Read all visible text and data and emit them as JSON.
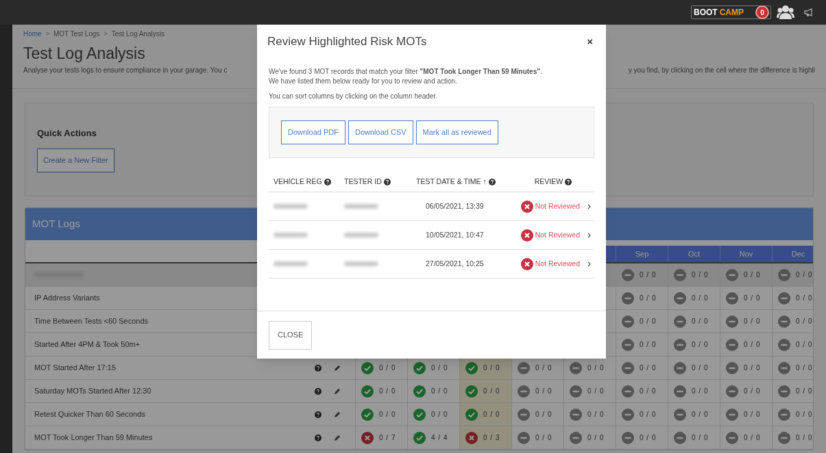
{
  "topbar": {
    "logo": {
      "part1": "BOOT",
      "part2": "CAMP"
    },
    "badge": "0"
  },
  "breadcrumb": [
    "Home",
    "MOT Test Logs",
    "Test Log Analysis"
  ],
  "breadcrumb_separator": ">",
  "page_title": "Test Log Analysis",
  "subtitle_left": "Analyse your tests logs to ensure compliance in your garage. You c",
  "subtitle_right": "y you find, by clicking on the cell where the difference is highli",
  "quick_actions": {
    "title": "Quick Actions",
    "button": "Create a New Filter"
  },
  "mot_logs": {
    "title": "MOT Logs",
    "columns": [
      {
        "highlighted": false
      },
      {
        "highlighted": false
      },
      {
        "highlighted": true
      },
      {
        "highlighted": false
      },
      {
        "highlighted": false
      },
      {
        "header": "Sep",
        "highlighted": false
      },
      {
        "header": "Oct",
        "highlighted": false
      },
      {
        "header": "Nov",
        "highlighted": false
      },
      {
        "header": "Dec",
        "highlighted": false
      }
    ],
    "rows": [
      {
        "kind": "group",
        "cells": [
          {
            "kind": "none",
            "value": "0 / 0"
          },
          {
            "kind": "none",
            "value": "0 / 0"
          },
          {
            "kind": "none",
            "value": "0 / 0"
          },
          {
            "kind": "none",
            "value": "0 / 0"
          }
        ]
      },
      {
        "kind": "filter",
        "label": "IP Address Variants",
        "cells": [
          {
            "kind": "none",
            "value": "0 / 0"
          },
          {
            "kind": "none",
            "value": "0 / 0"
          },
          {
            "kind": "none",
            "value": "0 / 0"
          },
          {
            "kind": "none",
            "value": "0 / 0"
          }
        ]
      },
      {
        "kind": "filter",
        "label": "Time Between Tests <60 Seconds",
        "cells": [
          {
            "kind": "none",
            "value": "0 / 0"
          },
          {
            "kind": "none",
            "value": "0 / 0"
          },
          {
            "kind": "none",
            "value": "0 / 0"
          },
          {
            "kind": "none",
            "value": "0 / 0"
          }
        ]
      },
      {
        "kind": "filter",
        "label": "Started After 4PM & Took 50m+",
        "cells": [
          {
            "kind": "none",
            "value": "0 / 0"
          },
          {
            "kind": "none",
            "value": "0 / 0"
          },
          {
            "kind": "none",
            "value": "0 / 0"
          },
          {
            "kind": "none",
            "value": "0 / 0"
          }
        ]
      },
      {
        "kind": "filter",
        "label": "MOT Started After 17:15",
        "cells": [
          {
            "kind": "ok",
            "value": "0 / 0"
          },
          {
            "kind": "ok",
            "value": "0 / 0"
          },
          {
            "kind": "ok",
            "value": "0 / 0"
          },
          {
            "kind": "none",
            "value": "0 / 0"
          },
          {
            "kind": "none",
            "value": "0 / 0"
          },
          {
            "kind": "none",
            "value": "0 / 0"
          },
          {
            "kind": "none",
            "value": "0 / 0"
          },
          {
            "kind": "none",
            "value": "0 / 0"
          },
          {
            "kind": "none",
            "value": "0 / 0"
          }
        ]
      },
      {
        "kind": "filter",
        "label": "Saturday MOTs Started After 12:30",
        "cells": [
          {
            "kind": "ok",
            "value": "0 / 0"
          },
          {
            "kind": "ok",
            "value": "0 / 0"
          },
          {
            "kind": "ok",
            "value": "0 / 0"
          },
          {
            "kind": "none",
            "value": "0 / 0"
          },
          {
            "kind": "none",
            "value": "0 / 0"
          },
          {
            "kind": "none",
            "value": "0 / 0"
          },
          {
            "kind": "none",
            "value": "0 / 0"
          },
          {
            "kind": "none",
            "value": "0 / 0"
          },
          {
            "kind": "none",
            "value": "0 / 0"
          }
        ]
      },
      {
        "kind": "filter",
        "label": "Retest Quicker Than 60 Seconds",
        "cells": [
          {
            "kind": "ok",
            "value": "0 / 0"
          },
          {
            "kind": "ok",
            "value": "0 / 0"
          },
          {
            "kind": "ok",
            "value": "0 / 0"
          },
          {
            "kind": "none",
            "value": "0 / 0"
          },
          {
            "kind": "none",
            "value": "0 / 0"
          },
          {
            "kind": "none",
            "value": "0 / 0"
          },
          {
            "kind": "none",
            "value": "0 / 0"
          },
          {
            "kind": "none",
            "value": "0 / 0"
          },
          {
            "kind": "none",
            "value": "0 / 0"
          }
        ]
      },
      {
        "kind": "filter",
        "label": "MOT Took Longer Than 59 Minutes",
        "cells": [
          {
            "kind": "fail",
            "value": "0 / 7"
          },
          {
            "kind": "ok",
            "value": "4 / 4"
          },
          {
            "kind": "fail",
            "value": "0 / 3"
          },
          {
            "kind": "none",
            "value": "0 / 0"
          },
          {
            "kind": "none",
            "value": "0 / 0"
          },
          {
            "kind": "none",
            "value": "0 / 0"
          },
          {
            "kind": "none",
            "value": "0 / 0"
          },
          {
            "kind": "none",
            "value": "0 / 0"
          },
          {
            "kind": "none",
            "value": "0 / 0"
          }
        ]
      }
    ]
  },
  "modal": {
    "title": "Review Highlighted Risk MOTs",
    "close_glyph": "×",
    "intro_lines": [
      "We've found 3 MOT records that match your filter **\"MOT Took Longer Than 59 Minutes\"**.",
      "We have listed them below ready for you to review and action."
    ],
    "sort_hint": "You can sort columns by clicking on the column header.",
    "actions": [
      "Download PDF",
      "Download CSV",
      "Mark all as reviewed"
    ],
    "columns": [
      {
        "label": "VEHICLE REG"
      },
      {
        "label": "TESTER ID"
      },
      {
        "label": "TEST DATE & TIME",
        "sort_glyph": "↑"
      },
      {
        "label": "REVIEW"
      }
    ],
    "rows": [
      {
        "date": "06/05/2021, 13:39",
        "review": "Not Reviewed",
        "reviewed": false
      },
      {
        "date": "10/05/2021, 10:47",
        "review": "Not Reviewed",
        "reviewed": false
      },
      {
        "date": "27/05/2021, 10:25",
        "review": "Not Reviewed",
        "reviewed": false
      }
    ],
    "footer_button": "CLOSE"
  }
}
